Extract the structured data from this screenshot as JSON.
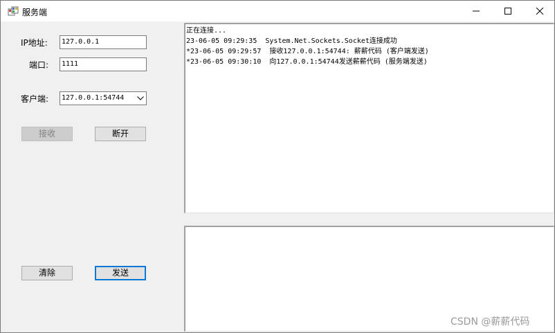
{
  "window": {
    "title": "服务端",
    "controls": {
      "minimize": "minimize-icon",
      "maximize": "maximize-icon",
      "close": "close-icon"
    }
  },
  "form": {
    "ip_label": "IP地址:",
    "ip_value": "127.0.0.1",
    "port_label": "端口:",
    "port_value": "1111",
    "client_label": "客户端:",
    "client_selected": "127.0.0.1:54744"
  },
  "buttons": {
    "receive": "接收",
    "disconnect": "断开",
    "clear": "清除",
    "send": "发送"
  },
  "log": {
    "lines": [
      "正在连接...",
      "23-06-05 09:29:35  System.Net.Sockets.Socket连接成功",
      "*23-06-05 09:29:57  接收127.0.0.1:54744: 薪薪代码 (客户端发送)",
      "*23-06-05 09:30:10  向127.0.0.1:54744发送薪薪代码 (服务端发送)"
    ]
  },
  "send_box": {
    "value": ""
  },
  "watermark": "CSDN @薪薪代码",
  "colors": {
    "accent": "#0078d7",
    "background": "#f0f0f0"
  }
}
